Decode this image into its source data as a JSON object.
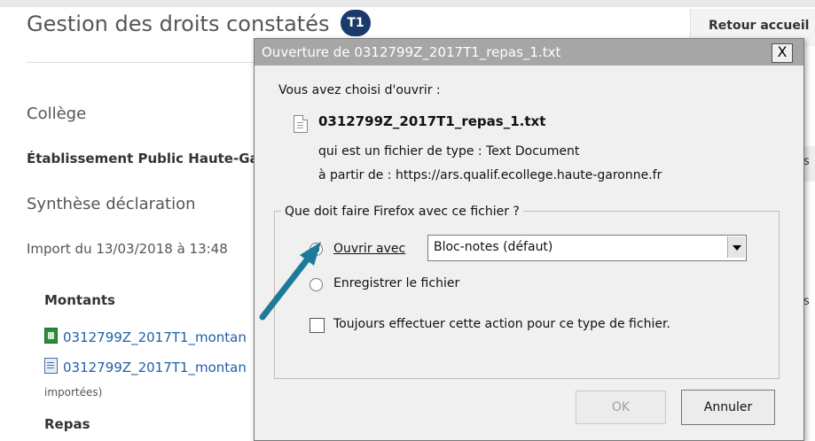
{
  "page": {
    "title": "Gestion des droits constatés",
    "badge": "T1",
    "retour": "Retour accueil",
    "college_label": "Collège",
    "etablissement": "Établissement Public Haute-Ga",
    "synthese": "Synthèse déclaration",
    "import_date": "Import du 13/03/2018 à 13:48",
    "montants_heading": "Montants",
    "files": [
      {
        "name": "0312799Z_2017T1_montan",
        "icon": "spreadsheet-file-icon"
      },
      {
        "name": "0312799Z_2017T1_montan",
        "icon": "text-file-icon"
      }
    ],
    "importees": "importées)",
    "repas_heading": "Repas",
    "right_fragment_1": "s",
    "right_fragment_2": "s"
  },
  "dialog": {
    "title": "Ouverture de 0312799Z_2017T1_repas_1.txt",
    "close": "X",
    "intro": "Vous avez choisi d'ouvrir :",
    "file_name": "0312799Z_2017T1_repas_1.txt",
    "type_line": "qui est un fichier de type :  Text Document",
    "source_line": "à partir de :  https://ars.qualif.ecollege.haute-garonne.fr",
    "question": "Que doit faire Firefox avec ce fichier ?",
    "open_with_label": "Ouvrir avec",
    "open_with_app": "Bloc-notes (défaut)",
    "save_label": "Enregistrer le fichier",
    "always_label": "Toujours effectuer cette action pour ce type de fichier.",
    "ok": "OK",
    "cancel": "Annuler",
    "selected_option": "Ouvrir avec",
    "always_checked": false
  },
  "colors": {
    "badge": "#1a3a6b",
    "link": "#1f5fa8",
    "arrow": "#1f7a99",
    "titlebar": "#a6a6a6"
  }
}
